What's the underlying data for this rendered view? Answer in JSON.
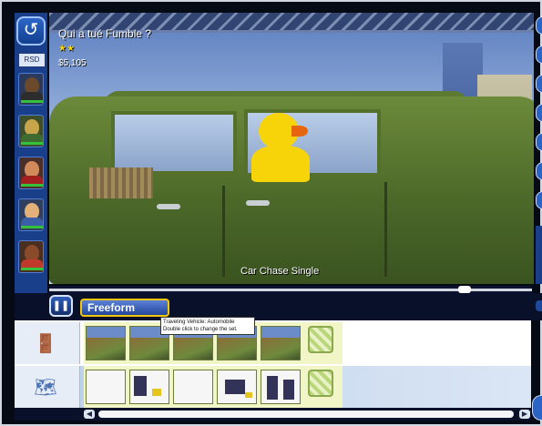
{
  "hud": {
    "title": "Qui a tué Fumble ?",
    "stars": "★★",
    "money": "$5,105"
  },
  "sidebar": {
    "back_icon": "↺",
    "badge": "RSD",
    "characters": [
      {
        "name": "character-1",
        "skin": "#6a4a2a",
        "shirt": "#2d2d2d"
      },
      {
        "name": "character-2",
        "skin": "#c7a54a",
        "shirt": "#3e6b2f"
      },
      {
        "name": "character-3",
        "skin": "#d28a5a",
        "shirt": "#a32020"
      },
      {
        "name": "character-4",
        "skin": "#e3b07a",
        "shirt": "#3a5ea8"
      },
      {
        "name": "character-5",
        "skin": "#8a4b2a",
        "shirt": "#c0392b"
      }
    ]
  },
  "viewport": {
    "caption": "Car Chase Single"
  },
  "controls": {
    "pause_icon": "❚❚",
    "mode_label": "Freeform"
  },
  "timeline": {
    "tooltip_line1": "Traveling Vehicle: Automobile",
    "tooltip_line2": "Double click to change the set.",
    "vehicle_icon": "🚪",
    "set_icon": "🗺"
  },
  "scroll": {
    "left_arrow": "◀",
    "right_arrow": "▶",
    "scrubber_position": 0.87
  },
  "colors": {
    "accent": "#2a64c4",
    "mode_border": "#f3c50b",
    "clip_area": "#f2f6c7"
  }
}
